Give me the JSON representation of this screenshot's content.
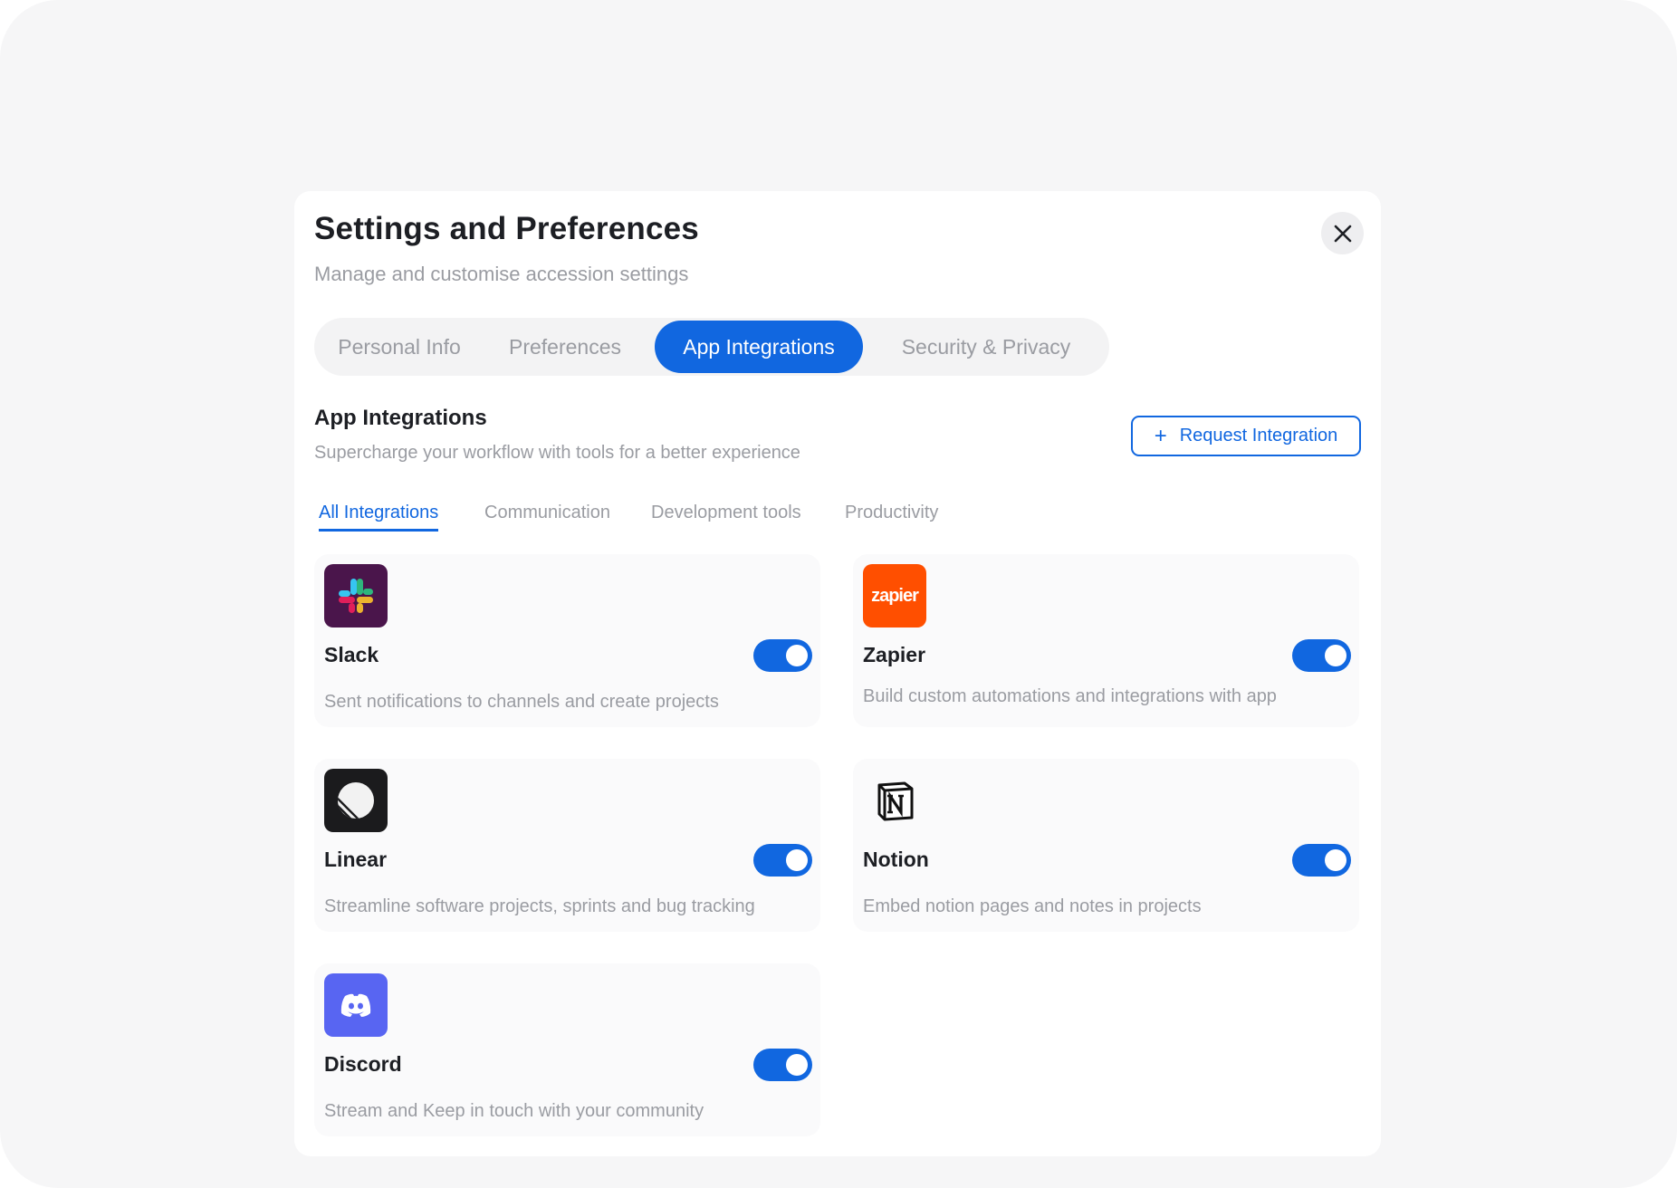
{
  "modal": {
    "title": "Settings and Preferences",
    "subtitle": "Manage and customise accession settings"
  },
  "tabs": [
    {
      "label": "Personal Info",
      "active": false
    },
    {
      "label": "Preferences",
      "active": false
    },
    {
      "label": "App Integrations",
      "active": true
    },
    {
      "label": "Security & Privacy",
      "active": false
    }
  ],
  "section": {
    "title": "App Integrations",
    "subtitle": "Supercharge your workflow with tools for a better experience",
    "request_button": "Request Integration"
  },
  "filters": [
    {
      "label": "All Integrations",
      "active": true
    },
    {
      "label": "Communication",
      "active": false
    },
    {
      "label": "Development tools",
      "active": false
    },
    {
      "label": "Productivity",
      "active": false
    }
  ],
  "integrations": [
    {
      "name": "Slack",
      "description": "Sent notifications to channels and create projects",
      "icon": "slack-logo",
      "enabled": true
    },
    {
      "name": "Zapier",
      "description": "Build custom automations and integrations with app",
      "icon": "zapier-logo",
      "logo_text": "zapier",
      "enabled": true
    },
    {
      "name": "Linear",
      "description": "Streamline software projects, sprints and bug tracking",
      "icon": "linear-logo",
      "enabled": true
    },
    {
      "name": "Notion",
      "description": "Embed notion pages and notes in projects",
      "icon": "notion-logo",
      "enabled": true
    },
    {
      "name": "Discord",
      "description": "Stream and Keep in touch with your community",
      "icon": "discord-logo",
      "enabled": true
    }
  ],
  "colors": {
    "accent": "#1167e0",
    "slack_bg": "#4a154b",
    "zapier_bg": "#ff4f00",
    "linear_bg": "#1b1b1d",
    "discord_bg": "#5865f2"
  }
}
